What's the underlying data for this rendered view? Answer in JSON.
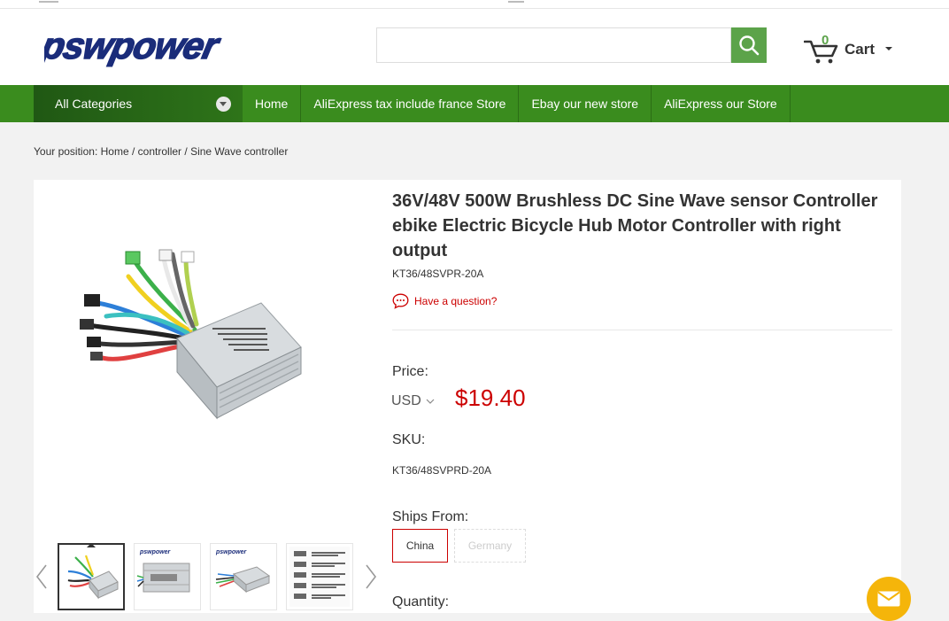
{
  "header": {
    "logo_text": "pswpower",
    "search": {
      "value": "",
      "placeholder": ""
    },
    "cart": {
      "count": "0",
      "label": "Cart"
    }
  },
  "nav": {
    "all_categories": "All Categories",
    "items": [
      {
        "label": "Home"
      },
      {
        "label": "AliExpress tax include france Store"
      },
      {
        "label": "Ebay our new store"
      },
      {
        "label": "AliExpress our Store"
      }
    ]
  },
  "breadcrumb": {
    "prefix": "Your position:",
    "items": [
      "Home",
      "controller",
      "Sine Wave controller"
    ],
    "separator": "/"
  },
  "product": {
    "title": "36V/48V 500W Brushless DC Sine Wave sensor Controller ebike Electric Bicycle Hub Motor Controller with right output",
    "model": "KT36/48SVPR-20A",
    "question_link": "Have a question?",
    "price_label": "Price:",
    "currency": "USD",
    "price": "$19.40",
    "sku_label": "SKU:",
    "sku_value": "KT36/48SVPRD-20A",
    "ships_from_label": "Ships From:",
    "ships_from_options": [
      {
        "label": "China",
        "selected": true
      },
      {
        "label": "Germany",
        "selected": false,
        "disabled": true
      }
    ],
    "quantity_label": "Quantity:"
  },
  "gallery": {
    "thumbnail_count": 4,
    "active_thumbnail": 1
  },
  "colors": {
    "brand_green": "#3a8c1e",
    "search_green": "#5ca34a",
    "price_red": "#cc0000",
    "logo_blue": "#1a2c7a",
    "mail_yellow": "#f5b50a"
  }
}
